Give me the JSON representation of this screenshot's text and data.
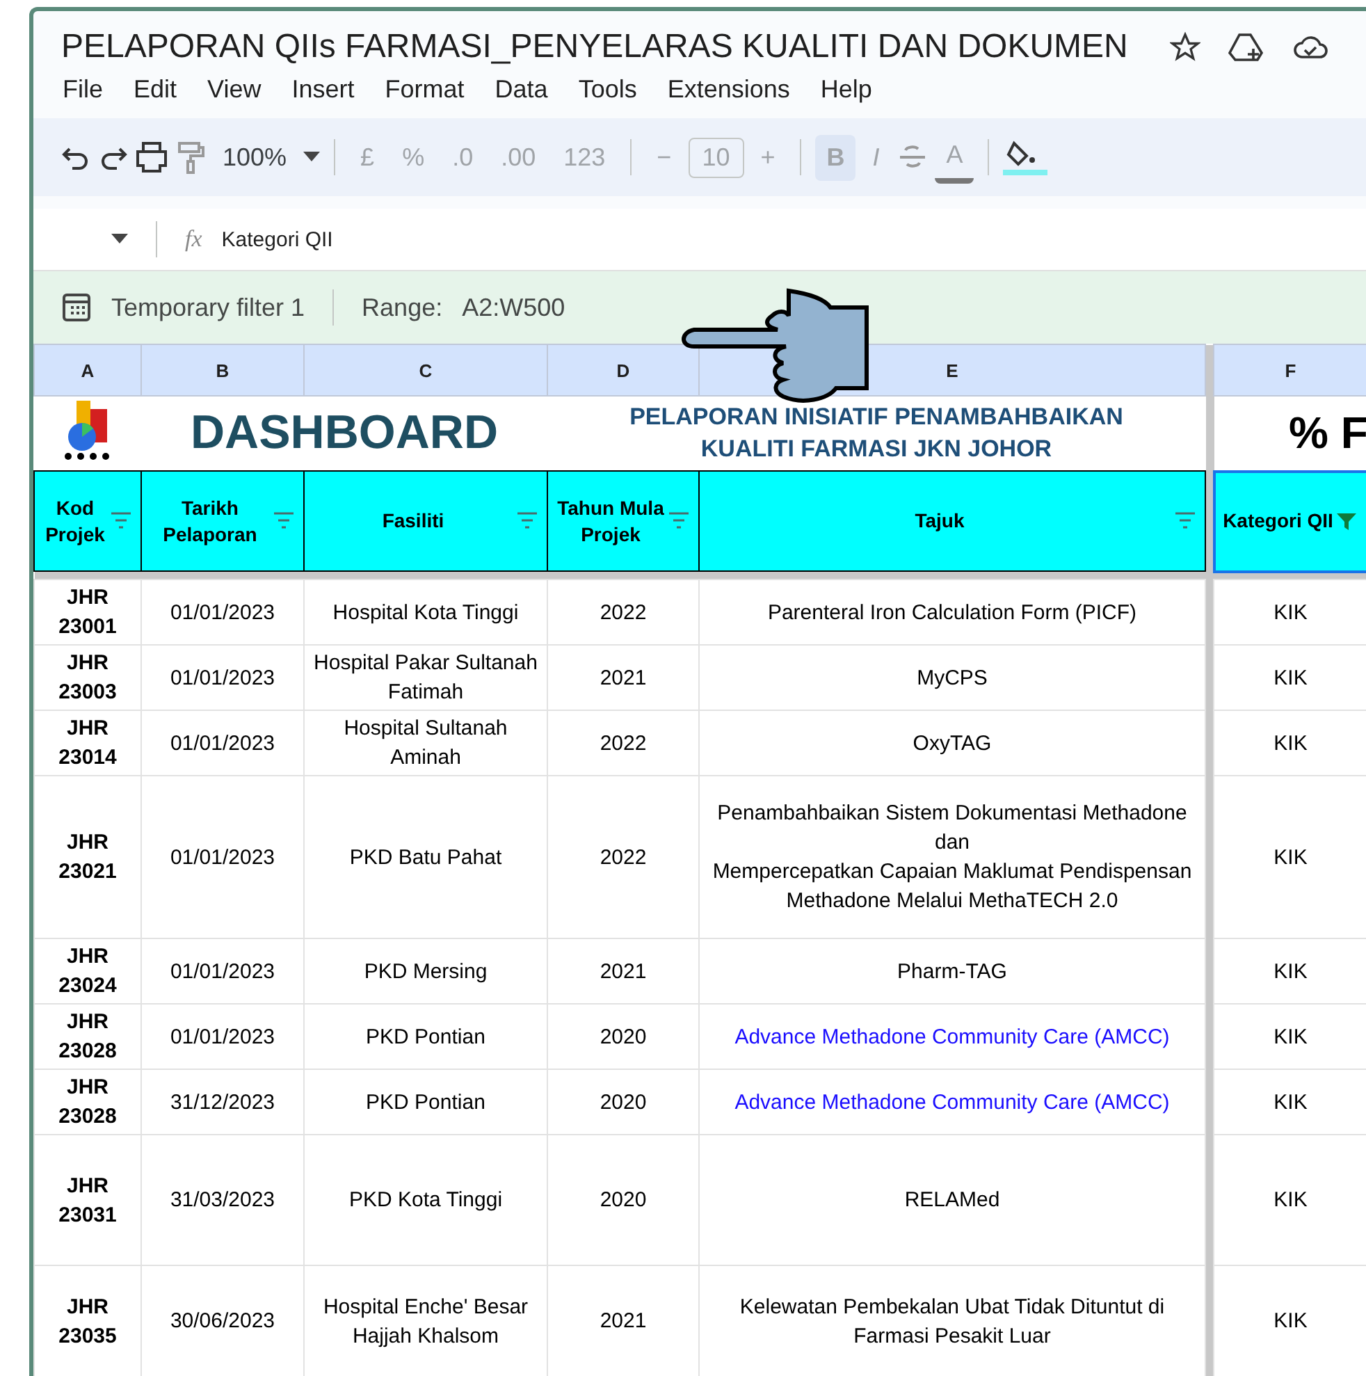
{
  "document": {
    "title": "PELAPORAN QIIs FARMASI_PENYELARAS KUALITI DAN DOKUMEN"
  },
  "menu": [
    "File",
    "Edit",
    "View",
    "Insert",
    "Format",
    "Data",
    "Tools",
    "Extensions",
    "Help"
  ],
  "toolbar": {
    "zoom": "100%",
    "number_formats": [
      "£",
      "%",
      ".0",
      ".00",
      "123"
    ],
    "decrease": "−",
    "font_size": "10",
    "increase": "+",
    "bold": "B",
    "italic": "I",
    "text_color": "A"
  },
  "formula_bar": {
    "fx": "fx",
    "content": "Kategori QII"
  },
  "filter_bar": {
    "name": "Temporary filter 1",
    "range_label": "Range:",
    "range": "A2:W500"
  },
  "column_letters": [
    "A",
    "B",
    "C",
    "D",
    "E",
    "F"
  ],
  "dashboard": {
    "title": "DASHBOARD",
    "subtitle": "PELAPORAN INISIATIF PENAMBAHBAIKAN\nKUALITI FARMASI JKN JOHOR",
    "column_f": "% F"
  },
  "headers": [
    {
      "label": "Kod Projek",
      "filter_active": false,
      "selected": false
    },
    {
      "label": "Tarikh Pelaporan",
      "filter_active": false,
      "selected": false
    },
    {
      "label": "Fasiliti",
      "filter_active": false,
      "selected": false
    },
    {
      "label": "Tahun Mula Projek",
      "filter_active": false,
      "selected": false
    },
    {
      "label": "Tajuk",
      "filter_active": false,
      "selected": false
    },
    {
      "label": "Kategori QII",
      "filter_active": true,
      "selected": true
    }
  ],
  "rows": [
    {
      "kod": "JHR 23001",
      "tarikh": "01/01/2023",
      "fasiliti": "Hospital Kota Tinggi",
      "tahun": "2022",
      "tajuk": "Parenteral Iron Calculation Form (PICF)",
      "link": false,
      "kategori": "KIK"
    },
    {
      "kod": "JHR 23003",
      "tarikh": "01/01/2023",
      "fasiliti": "Hospital Pakar Sultanah Fatimah",
      "tahun": "2021",
      "tajuk": "MyCPS",
      "link": false,
      "kategori": "KIK"
    },
    {
      "kod": "JHR 23014",
      "tarikh": "01/01/2023",
      "fasiliti": "Hospital Sultanah Aminah",
      "tahun": "2022",
      "tajuk": "OxyTAG",
      "link": false,
      "kategori": "KIK"
    },
    {
      "kod": "JHR 23021",
      "tarikh": "01/01/2023",
      "fasiliti": "PKD Batu Pahat",
      "tahun": "2022",
      "tajuk": "Penambahbaikan Sistem Dokumentasi Methadone dan\nMempercepatkan Capaian Maklumat Pendispensan Methadone Melalui MethaTECH 2.0",
      "link": false,
      "kategori": "KIK"
    },
    {
      "kod": "JHR 23024",
      "tarikh": "01/01/2023",
      "fasiliti": "PKD Mersing",
      "tahun": "2021",
      "tajuk": "Pharm-TAG",
      "link": false,
      "kategori": "KIK"
    },
    {
      "kod": "JHR 23028",
      "tarikh": "01/01/2023",
      "fasiliti": "PKD Pontian",
      "tahun": "2020",
      "tajuk": "Advance Methadone Community Care (AMCC)",
      "link": true,
      "kategori": "KIK"
    },
    {
      "kod": "JHR 23028",
      "tarikh": "31/12/2023",
      "fasiliti": "PKD Pontian",
      "tahun": "2020",
      "tajuk": "Advance Methadone Community Care (AMCC)",
      "link": true,
      "kategori": "KIK"
    },
    {
      "kod": "JHR 23031",
      "tarikh": "31/03/2023",
      "fasiliti": "PKD Kota Tinggi",
      "tahun": "2020",
      "tajuk": "RELAMed",
      "link": false,
      "kategori": "KIK"
    },
    {
      "kod": "JHR 23035",
      "tarikh": "30/06/2023",
      "fasiliti": "Hospital Enche' Besar Hajjah Khalsom",
      "tahun": "2021",
      "tajuk": "Kelewatan Pembekalan Ubat Tidak Dituntut di Farmasi Pesakit Luar",
      "link": false,
      "kategori": "KIK"
    }
  ]
}
